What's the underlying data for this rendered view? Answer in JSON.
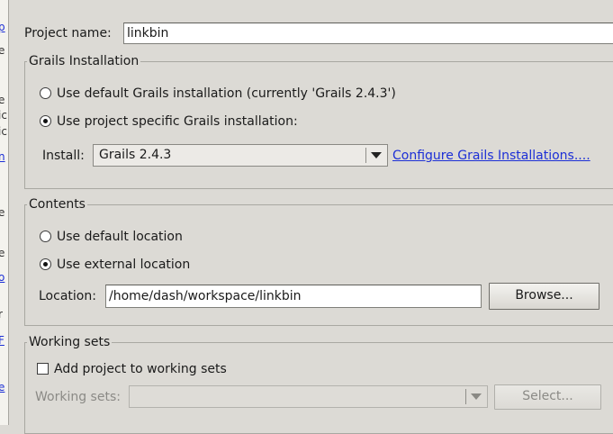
{
  "left_strip": {
    "fragments": [
      "p",
      "e",
      "e",
      "ic",
      "ic",
      "n",
      "e",
      "e",
      "o",
      "r",
      "F",
      "e"
    ]
  },
  "project_name": {
    "label": "Project name:",
    "value": "linkbin"
  },
  "grails_installation": {
    "title": "Grails Installation",
    "option_default": "Use default Grails installation (currently 'Grails 2.4.3')",
    "option_specific": "Use project specific Grails installation:",
    "selected": "specific",
    "install_label": "Install:",
    "install_value": "Grails 2.4.3",
    "configure_link": "Configure Grails Installations...."
  },
  "contents": {
    "title": "Contents",
    "option_default": "Use default location",
    "option_external": "Use external location",
    "selected": "external",
    "location_label": "Location:",
    "location_value": "/home/dash/workspace/linkbin",
    "browse_label": "Browse..."
  },
  "working_sets": {
    "title": "Working sets",
    "add_checkbox_label": "Add project to working sets",
    "add_checked": false,
    "sets_label": "Working sets:",
    "sets_value": "",
    "select_label": "Select..."
  }
}
